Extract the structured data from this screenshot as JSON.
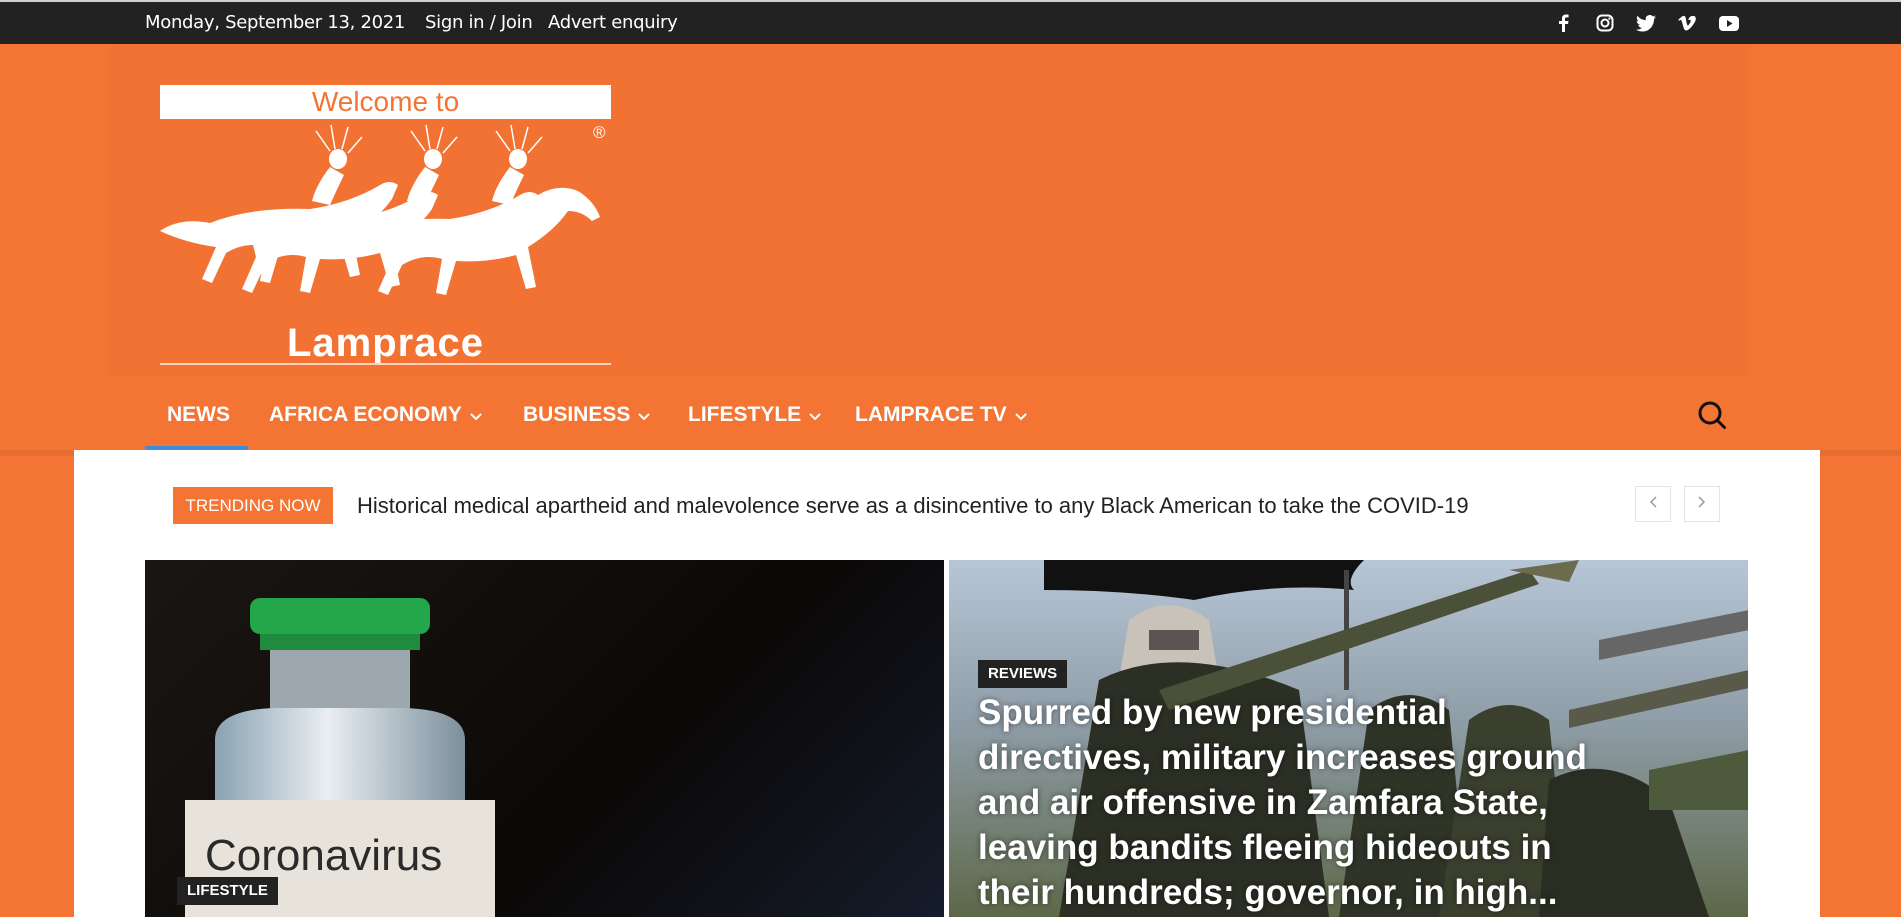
{
  "topbar": {
    "date": "Monday, September 13, 2021",
    "links": [
      {
        "label": "Sign in / Join"
      },
      {
        "label": "Advert enquiry"
      }
    ],
    "social_icons": [
      "facebook-icon",
      "instagram-icon",
      "twitter-icon",
      "vimeo-icon",
      "youtube-icon"
    ]
  },
  "logo": {
    "banner": "Welcome to",
    "brand": "Lamprace",
    "registered": "®"
  },
  "nav": {
    "items": [
      {
        "label": "NEWS",
        "dropdown": false,
        "active": true
      },
      {
        "label": "AFRICA ECONOMY",
        "dropdown": true
      },
      {
        "label": "BUSINESS",
        "dropdown": true
      },
      {
        "label": "LIFESTYLE",
        "dropdown": true
      },
      {
        "label": "LAMPRACE TV",
        "dropdown": true
      }
    ]
  },
  "trending": {
    "label": "TRENDING NOW",
    "headline": "Historical medical apartheid and malevolence serve as a disincentive to any Black American to take the COVID-19"
  },
  "featured": [
    {
      "category": "LIFESTYLE",
      "vial_text": "Coronavirus"
    },
    {
      "category": "REVIEWS",
      "title": "Spurred by new presidential directives, military increases ground and air offensive in Zamfara State, leaving bandits fleeing hideouts in their hundreds; governor, in high..."
    }
  ],
  "colors": {
    "brand_orange": "#f47434",
    "topbar_bg": "#222222",
    "active_underline": "#3b8edb"
  }
}
